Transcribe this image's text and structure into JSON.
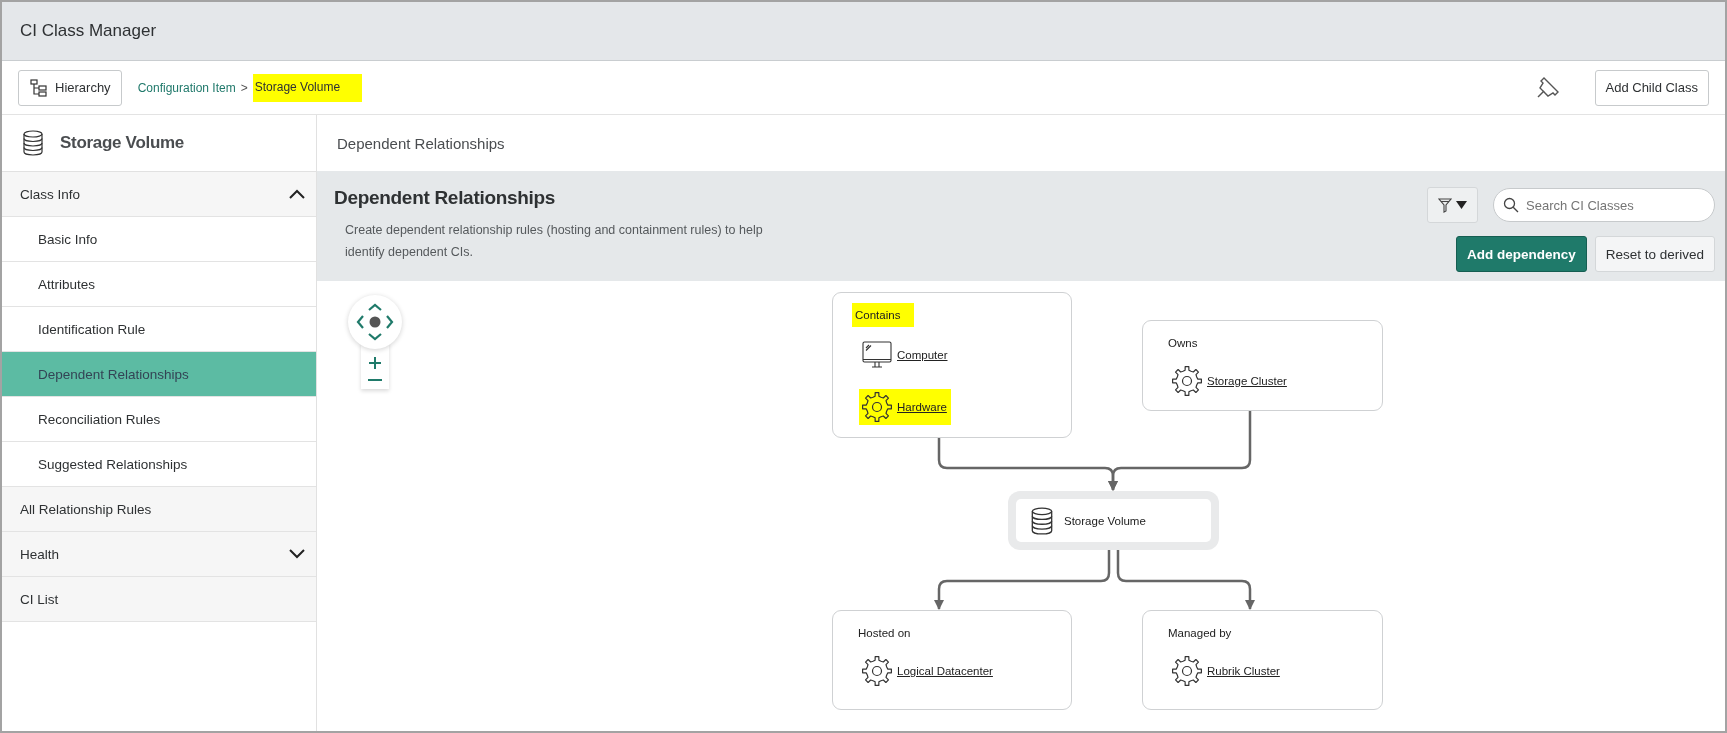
{
  "window": {
    "title": "CI Class Manager"
  },
  "toolbar": {
    "hierarchy_button": "Hierarchy",
    "breadcrumb": [
      {
        "label": "Configuration Item",
        "current": false,
        "highlighted": false
      },
      {
        "label": "Storage Volume",
        "current": true,
        "highlighted": true
      }
    ],
    "separator": ">",
    "add_child_button": "Add Child Class"
  },
  "sidebar": {
    "title": "Storage Volume",
    "sections": [
      {
        "label": "Class Info",
        "kind": "group",
        "expanded": true,
        "children": [
          {
            "label": "Basic Info",
            "selected": false
          },
          {
            "label": "Attributes",
            "selected": false
          },
          {
            "label": "Identification Rule",
            "selected": false
          },
          {
            "label": "Dependent Relationships",
            "selected": true
          },
          {
            "label": "Reconciliation Rules",
            "selected": false
          },
          {
            "label": "Suggested Relationships",
            "selected": false
          }
        ]
      },
      {
        "label": "All Relationship Rules",
        "kind": "link"
      },
      {
        "label": "Health",
        "kind": "group",
        "expanded": false
      },
      {
        "label": "CI List",
        "kind": "link"
      }
    ]
  },
  "main": {
    "heading": "Dependent Relationships",
    "panel": {
      "title": "Dependent Relationships",
      "description": "Create dependent relationship rules (hosting and containment rules) to help identify dependent CIs.",
      "search_placeholder": "Search CI Classes",
      "buttons": [
        {
          "label": "Add dependency",
          "kind": "primary"
        },
        {
          "label": "Reset to derived",
          "kind": "secondary"
        }
      ]
    },
    "diagram": {
      "center": {
        "label": "Storage Volume"
      },
      "upstream": [
        {
          "label": "Contains",
          "highlighted": true,
          "items": [
            {
              "label": "Computer",
              "kind": "computer",
              "highlighted": false
            },
            {
              "label": "Hardware",
              "kind": "class",
              "highlighted": true
            }
          ]
        },
        {
          "label": "Owns",
          "highlighted": false,
          "items": [
            {
              "label": "Storage Cluster",
              "kind": "class",
              "highlighted": false
            }
          ]
        }
      ],
      "downstream": [
        {
          "label": "Hosted on",
          "highlighted": false,
          "items": [
            {
              "label": "Logical Datacenter",
              "kind": "class",
              "highlighted": false
            }
          ]
        },
        {
          "label": "Managed by",
          "highlighted": false,
          "items": [
            {
              "label": "Rubrik Cluster",
              "kind": "class",
              "highlighted": false
            }
          ]
        }
      ]
    }
  }
}
